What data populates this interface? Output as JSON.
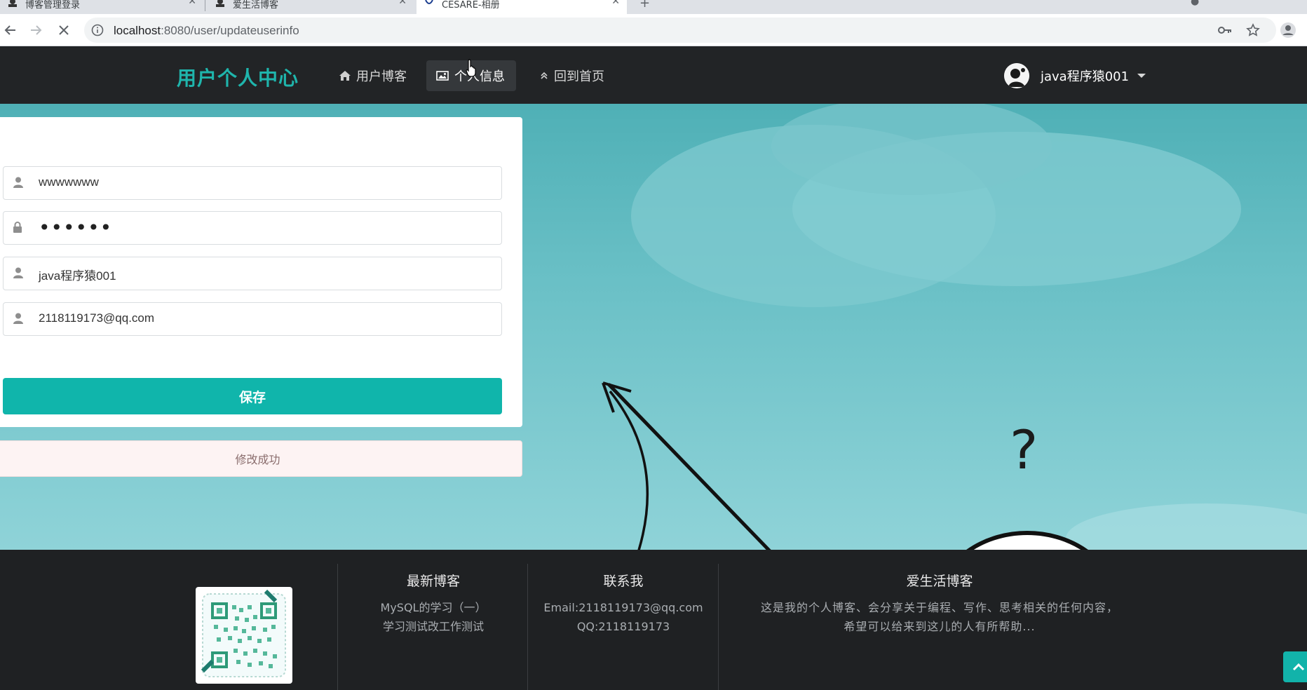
{
  "browser": {
    "tabs": [
      {
        "label": "博客管理登录"
      },
      {
        "label": "爱生活博客"
      },
      {
        "label": "CESARE-相册"
      }
    ],
    "url_host": "localhost",
    "url_rest": ":8080/user/updateuserinfo"
  },
  "navbar": {
    "brand": "用户个人中心",
    "items": [
      {
        "label": "用户博客",
        "icon": "home-icon"
      },
      {
        "label": "个人信息",
        "icon": "picture-icon"
      },
      {
        "label": "回到首页",
        "icon": "double-chevron-up-icon"
      }
    ],
    "username": "java程序猿001"
  },
  "form": {
    "username_value": "wwwwwww",
    "password_mask": "••••••",
    "nickname_value": "java程序猿001",
    "email_value": "2118119173@qq.com",
    "save_label": "保存"
  },
  "alert": {
    "message": "修改成功"
  },
  "footer": {
    "latest": {
      "title": "最新博客",
      "lines": [
        "MySQL的学习（一）",
        "学习测试改工作测试"
      ]
    },
    "contact": {
      "title": "联系我",
      "email": "Email:2118119173@qq.com",
      "qq": "QQ:2118119173"
    },
    "about": {
      "title": "爱生活博客",
      "lines": [
        "这是我的个人博客、会分享关于编程、写作、思考相关的任何内容，",
        "希望可以给来到这儿的人有所帮助..."
      ]
    }
  },
  "colors": {
    "accent": "#10b5ab",
    "navbar_bg": "#222426",
    "footer_bg": "#1f2123"
  }
}
